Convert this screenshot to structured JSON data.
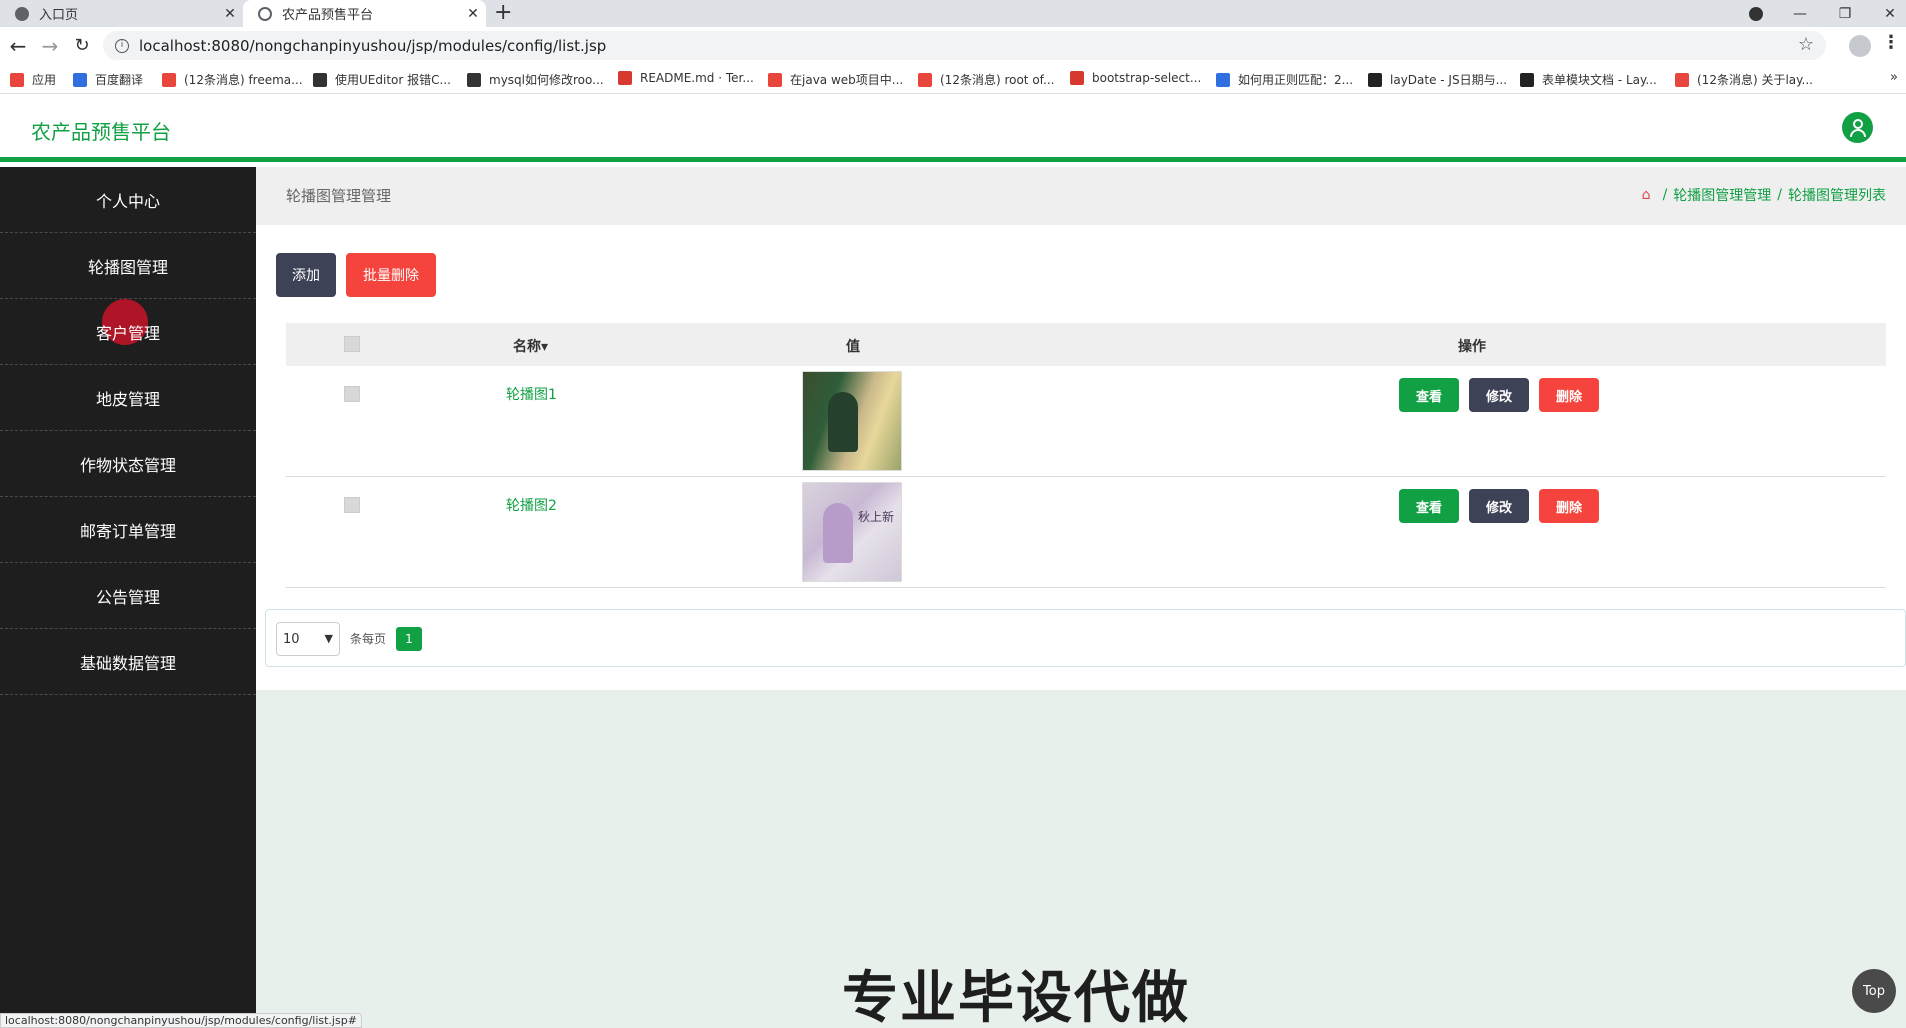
{
  "browser": {
    "tabs": [
      {
        "title": "入口页",
        "active": false
      },
      {
        "title": "农产品预售平台",
        "active": true
      }
    ],
    "new_tab_icon": "plus-icon",
    "url": "localhost:8080/nongchanpinyushou/jsp/modules/config/list.jsp",
    "bookmarks": [
      {
        "label": "应用",
        "color": "#e8453c"
      },
      {
        "label": "百度翻译",
        "color": "#2f6fe0"
      },
      {
        "label": "(12条消息) freema...",
        "color": "#e8453c"
      },
      {
        "label": "使用UEditor 报错C...",
        "color": "#333333"
      },
      {
        "label": "mysql如何修改roo...",
        "color": "#333333"
      },
      {
        "label": "README.md · Ter...",
        "color": "#d63a2f"
      },
      {
        "label": "在java web项目中...",
        "color": "#e8453c"
      },
      {
        "label": "(12条消息) root of...",
        "color": "#e8453c"
      },
      {
        "label": "bootstrap-select...",
        "color": "#d63a2f"
      },
      {
        "label": "如何用正则匹配：2...",
        "color": "#2f6fe0"
      },
      {
        "label": "layDate - JS日期与...",
        "color": "#222222"
      },
      {
        "label": "表单模块文档 - Lay...",
        "color": "#222222"
      },
      {
        "label": "(12条消息) 关于lay...",
        "color": "#e8453c"
      }
    ],
    "status_text": "localhost:8080/nongchanpinyushou/jsp/modules/config/list.jsp#"
  },
  "app": {
    "title": "农产品预售平台",
    "accent": "#11a044",
    "danger": "#f5443d",
    "dark": "#3e4257"
  },
  "sidebar": {
    "items": [
      {
        "label": "个人中心"
      },
      {
        "label": "轮播图管理"
      },
      {
        "label": "客户管理"
      },
      {
        "label": "地皮管理"
      },
      {
        "label": "作物状态管理"
      },
      {
        "label": "邮寄订单管理"
      },
      {
        "label": "公告管理"
      },
      {
        "label": "基础数据管理"
      }
    ]
  },
  "page": {
    "title": "轮播图管理管理",
    "breadcrumb": [
      "轮播图管理管理",
      "轮播图管理列表"
    ],
    "breadcrumb_sep": "/",
    "add_label": "添加",
    "batch_delete_label": "批量删除"
  },
  "table": {
    "headers": {
      "name": "名称",
      "value": "值",
      "action": "操作"
    },
    "rows": [
      {
        "name": "轮播图1",
        "thumb_text": ""
      },
      {
        "name": "轮播图2",
        "thumb_text": "秋上新"
      }
    ],
    "actions": {
      "view": "查看",
      "edit": "修改",
      "delete": "删除"
    }
  },
  "pager": {
    "page_size": "10",
    "per_page_label": "条每页",
    "current_page": "1"
  },
  "watermark": "专业毕设代做",
  "top_button": "Top"
}
